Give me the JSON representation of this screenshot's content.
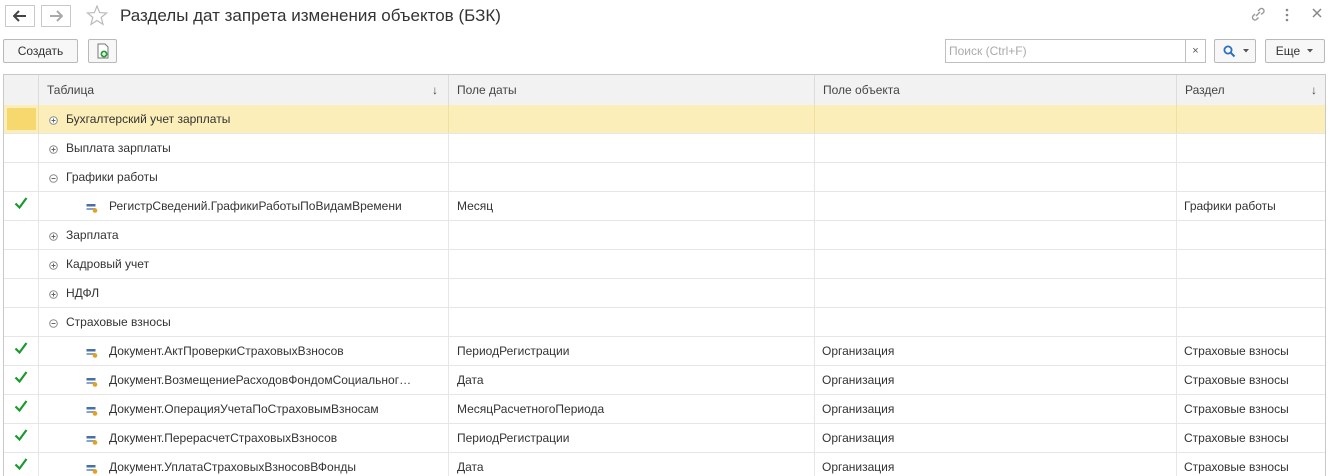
{
  "window": {
    "title": "Разделы дат запрета изменения объектов (БЗК)"
  },
  "toolbar": {
    "create_label": "Создать",
    "search_placeholder": "Поиск (Ctrl+F)",
    "search_clear": "×",
    "more_label": "Еще"
  },
  "table": {
    "headers": {
      "table": "Таблица",
      "date_field": "Поле даты",
      "object_field": "Поле объекта",
      "section": "Раздел"
    },
    "rows": [
      {
        "kind": "group",
        "expanded": false,
        "selected": true,
        "checked": false,
        "table": "Бухгалтерский учет зарплаты",
        "date_field": "",
        "object_field": "",
        "section": ""
      },
      {
        "kind": "group",
        "expanded": false,
        "selected": false,
        "checked": false,
        "table": "Выплата зарплаты",
        "date_field": "",
        "object_field": "",
        "section": ""
      },
      {
        "kind": "group",
        "expanded": true,
        "selected": false,
        "checked": false,
        "table": "Графики работы",
        "date_field": "",
        "object_field": "",
        "section": ""
      },
      {
        "kind": "item",
        "selected": false,
        "checked": true,
        "table": "РегистрСведений.ГрафикиРаботыПоВидамВремени",
        "date_field": "Месяц",
        "object_field": "",
        "section": "Графики работы"
      },
      {
        "kind": "group",
        "expanded": false,
        "selected": false,
        "checked": false,
        "table": "Зарплата",
        "date_field": "",
        "object_field": "",
        "section": ""
      },
      {
        "kind": "group",
        "expanded": false,
        "selected": false,
        "checked": false,
        "table": "Кадровый учет",
        "date_field": "",
        "object_field": "",
        "section": ""
      },
      {
        "kind": "group",
        "expanded": false,
        "selected": false,
        "checked": false,
        "table": "НДФЛ",
        "date_field": "",
        "object_field": "",
        "section": ""
      },
      {
        "kind": "group",
        "expanded": true,
        "selected": false,
        "checked": false,
        "table": "Страховые взносы",
        "date_field": "",
        "object_field": "",
        "section": ""
      },
      {
        "kind": "item",
        "selected": false,
        "checked": true,
        "table": "Документ.АктПроверкиСтраховыхВзносов",
        "date_field": "ПериодРегистрации",
        "object_field": "Организация",
        "section": "Страховые взносы"
      },
      {
        "kind": "item",
        "selected": false,
        "checked": true,
        "table": "Документ.ВозмещениеРасходовФондомСоциальног…",
        "date_field": "Дата",
        "object_field": "Организация",
        "section": "Страховые взносы"
      },
      {
        "kind": "item",
        "selected": false,
        "checked": true,
        "table": "Документ.ОперацияУчетаПоСтраховымВзносам",
        "date_field": "МесяцРасчетногоПериода",
        "object_field": "Организация",
        "section": "Страховые взносы"
      },
      {
        "kind": "item",
        "selected": false,
        "checked": true,
        "table": "Документ.ПерерасчетСтраховыхВзносов",
        "date_field": "ПериодРегистрации",
        "object_field": "Организация",
        "section": "Страховые взносы"
      },
      {
        "kind": "item",
        "selected": false,
        "checked": true,
        "table": "Документ.УплатаСтраховыхВзносовВФонды",
        "date_field": "Дата",
        "object_field": "Организация",
        "section": "Страховые взносы"
      }
    ]
  },
  "colors": {
    "selected_row": "#fbeeb8",
    "check_green": "#1a9a2e",
    "header_bg": "#f2f2f2"
  }
}
